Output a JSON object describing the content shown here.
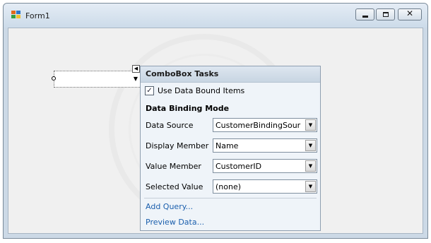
{
  "window": {
    "title": "Form1",
    "minimize_icon": "minimize-icon",
    "maximize_icon": "maximize-icon",
    "close_icon": "close-icon",
    "close_glyph": "✕",
    "app_icon": "form-icon"
  },
  "designer": {
    "combobox_arrow": "▼",
    "smart_tag_glyph": "◀"
  },
  "tasks": {
    "header": "ComboBox Tasks",
    "use_data_bound_items": {
      "label": "Use Data Bound Items",
      "checked": true,
      "glyph": "✓"
    },
    "section_title": "Data Binding Mode",
    "properties": [
      {
        "label": "Data Source",
        "value": "CustomerBindingSour"
      },
      {
        "label": "Display Member",
        "value": "Name"
      },
      {
        "label": "Value Member",
        "value": "CustomerID"
      },
      {
        "label": "Selected Value",
        "value": "(none)"
      }
    ],
    "dropdown_arrow": "▼",
    "links": [
      "Add Query...",
      "Preview Data..."
    ]
  },
  "colors": {
    "titlebar": "#ccdbe9",
    "panel": "#eff4f9",
    "link": "#1b5fad"
  }
}
